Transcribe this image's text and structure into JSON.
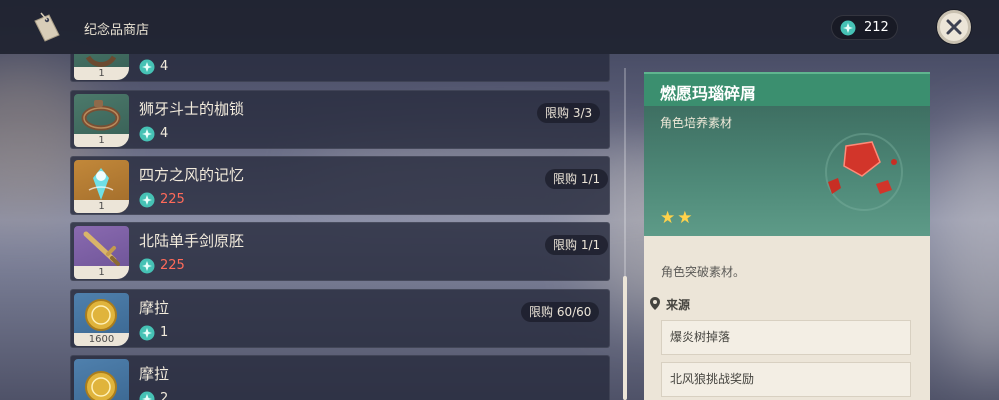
{
  "app": {
    "title": "纪念品商店"
  },
  "currency": {
    "icon": "starglitter-icon",
    "amount": "212"
  },
  "items": [
    {
      "name": "",
      "qty": "1",
      "price": "4",
      "price_color": "normal",
      "limit": "",
      "quality": "green",
      "icon": "shackle-icon"
    },
    {
      "name": "狮牙斗士的枷锁",
      "qty": "1",
      "price": "4",
      "price_color": "normal",
      "limit": "限购 3/3",
      "quality": "green",
      "icon": "shackle-icon"
    },
    {
      "name": "四方之风的记忆",
      "qty": "1",
      "price": "225",
      "price_color": "red",
      "limit": "限购 1/1",
      "quality": "orange",
      "icon": "wind-memory-icon"
    },
    {
      "name": "北陆单手剑原胚",
      "qty": "1",
      "price": "225",
      "price_color": "red",
      "limit": "限购 1/1",
      "quality": "purple",
      "icon": "sword-billet-icon"
    },
    {
      "name": "摩拉",
      "qty": "1600",
      "price": "1",
      "price_color": "normal",
      "limit": "限购 60/60",
      "quality": "blue",
      "icon": "mora-icon"
    },
    {
      "name": "摩拉",
      "qty": "",
      "price": "2",
      "price_color": "normal",
      "limit": "",
      "quality": "blue",
      "icon": "mora-icon"
    }
  ],
  "detail": {
    "title": "燃愿玛瑙碎屑",
    "category": "角色培养素材",
    "stars": 2,
    "description": "角色突破素材。",
    "source_label": "来源",
    "sources": [
      "爆炎树掉落",
      "北风狼挑战奖励"
    ],
    "accent": "#3b8f6f"
  },
  "colors": {
    "price_red": "#ff6a5a",
    "star": "#ffd24a"
  }
}
